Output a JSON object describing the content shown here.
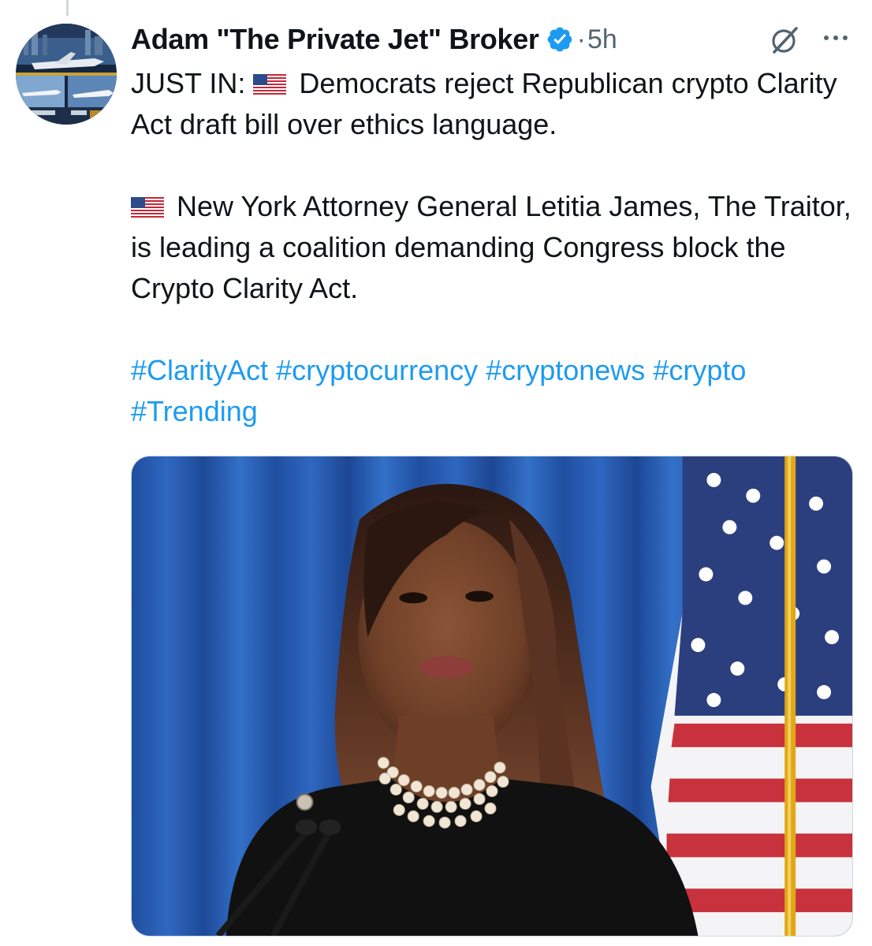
{
  "tweet": {
    "author": {
      "display_name": "Adam \"The Private Jet\" Broker",
      "verified": true,
      "avatar_icon": "private-jet-collage-avatar"
    },
    "separator": "·",
    "timestamp": "5h",
    "text": {
      "line1_prefix": "JUST IN:",
      "line1_body": "Democrats reject Republican crypto Clarity Act draft bill over ethics language.",
      "line2_body": "New York Attorney General Letitia James, The Traitor, is leading a coalition demanding Congress block the Crypto Clarity Act.",
      "hashtags": [
        "#ClarityAct",
        "#cryptocurrency",
        "#cryptonews",
        "#crypto",
        "#Trending"
      ]
    },
    "media": {
      "type": "photo"
    },
    "icons": {
      "verified": "verified-badge-icon",
      "flag": "us-flag-icon",
      "grok": "grok-icon",
      "more": "more-icon"
    }
  },
  "colors": {
    "link": "#1d9bf0",
    "verified": "#1d9bf0",
    "secondary_text": "#536471",
    "primary_text": "#0f1419"
  }
}
